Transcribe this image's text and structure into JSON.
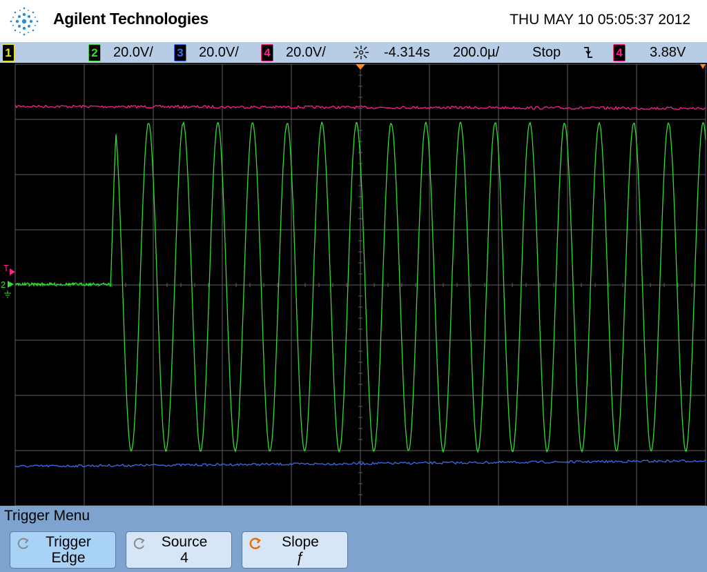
{
  "header": {
    "brand": "Agilent Technologies",
    "datetime": "THU MAY 10 05:05:37 2012"
  },
  "status_bar": {
    "ch1_label": "1",
    "ch2_label": "2",
    "ch2_scale": "20.0V/",
    "ch3_label": "3",
    "ch3_scale": "20.0V/",
    "ch4_label": "4",
    "ch4_scale": "20.0V/",
    "time_delay": "-4.314s",
    "time_scale": "200.0µ/",
    "run_state": "Stop",
    "trigger_source": "4",
    "trigger_level": "3.88V"
  },
  "colors": {
    "ch1": "#e8e800",
    "ch2": "#33dd33",
    "ch3": "#3a6cf0",
    "ch4": "#ff1f8c",
    "trigger_marker": "#ff8a1f",
    "grid": "#606060"
  },
  "screen_markers": {
    "trigger_marker_label": "T",
    "ground_marker_label": "2"
  },
  "menu": {
    "title": "Trigger Menu",
    "softkeys": [
      {
        "icon": "rotate-knob-icon",
        "line1": "Trigger",
        "line2": "Edge"
      },
      {
        "icon": "rotate-knob-icon",
        "line1": "Source",
        "line2": "4"
      },
      {
        "icon": "rotate-knob-active-icon",
        "line1": "Slope",
        "line2": "ƒ"
      }
    ]
  }
}
